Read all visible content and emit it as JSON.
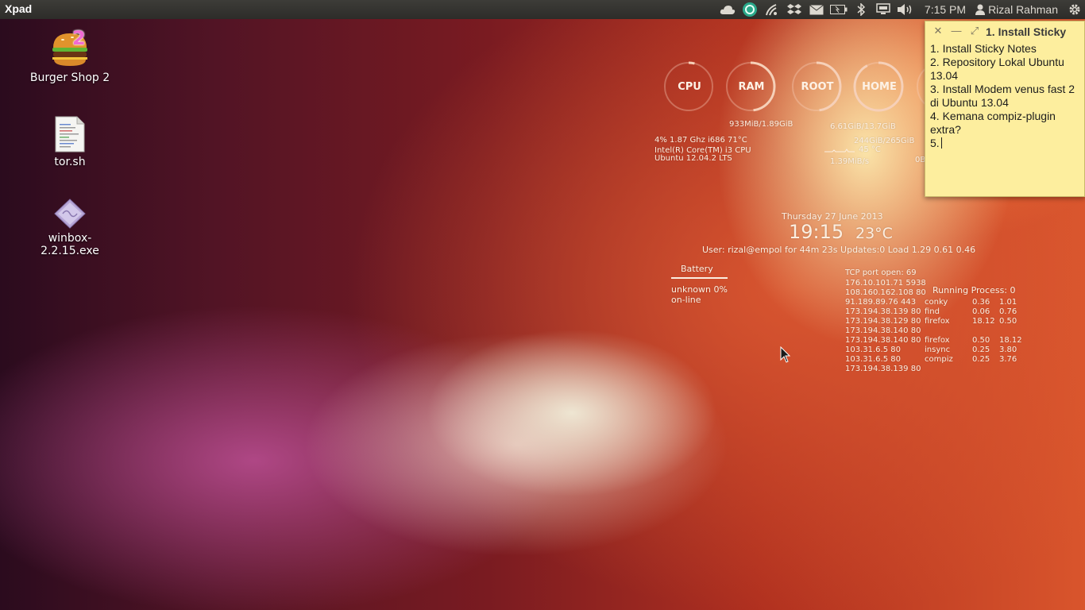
{
  "panel": {
    "app_title": "Xpad",
    "clock": "7:15 PM",
    "user": "Rizal Rahman",
    "indicators": [
      "cloud-icon",
      "sync-icon",
      "network-signal-icon",
      "dropbox-icon",
      "mail-icon",
      "battery-icon",
      "bluetooth-icon",
      "display-icon",
      "volume-icon",
      "user-icon",
      "session-gear-icon"
    ]
  },
  "desktop": {
    "icons": [
      {
        "label": "Burger Shop 2",
        "icon": "burger-game-icon"
      },
      {
        "label": "tor.sh",
        "icon": "text-file-icon"
      },
      {
        "label": "winbox-2.2.15.exe",
        "icon": "executable-icon"
      }
    ]
  },
  "conky": {
    "rings": [
      {
        "label": "CPU",
        "level": 0.04
      },
      {
        "label": "RAM",
        "level": 0.48
      },
      {
        "label": "ROOT",
        "level": 0.48
      },
      {
        "label": "HOME",
        "level": 0.92
      }
    ],
    "ram_text": "933MiB/1.89GiB",
    "root_text": "6.61GiB/13.7GiB",
    "home_text": "244GiB/265GiB",
    "cpu_line": "4% 1.87 Ghz i686  71°C",
    "cpu_model": "Intel(R) Core(TM) i3 CPU",
    "os": "Ubuntu 12.04.2 LTS",
    "disk_temp": "45 °C",
    "net_speed": "1.39MiB/s",
    "partial_text": "0B",
    "date": "Thursday 27 June 2013",
    "time": "19:15",
    "temp": "23°C",
    "user_line": "User: rizal@empol for 44m 23s  Updates:0   Load 1.29 0.61 0.46",
    "battery_title": "Battery",
    "battery_status": "unknown 0%",
    "battery_line": "on-line",
    "tcp_title": "TCP port open: 69",
    "tcp_ports": [
      "176.10.101.71 5938",
      "108.160.162.108 80",
      "91.189.89.76 443",
      "173.194.38.139 80",
      "173.194.38.129 80",
      "173.194.38.140 80",
      "173.194.38.140 80",
      "103.31.6.5 80",
      "103.31.6.5 80",
      "173.194.38.139 80"
    ],
    "process_title": "Running Process:  0",
    "processes_top": [
      {
        "name": "conky",
        "a": "0.36",
        "b": "1.01"
      },
      {
        "name": "find",
        "a": "0.06",
        "b": "0.76"
      },
      {
        "name": "firefox",
        "a": "18.12",
        "b": "0.50"
      }
    ],
    "processes_bottom": [
      {
        "name": "firefox",
        "a": "0.50",
        "b": "18.12"
      },
      {
        "name": "insync",
        "a": "0.25",
        "b": "3.80"
      },
      {
        "name": "compiz",
        "a": "0.25",
        "b": "3.76"
      }
    ]
  },
  "sticky": {
    "title": "1. Install Sticky",
    "close": "✕",
    "minimize": "—",
    "maximize": "⤢",
    "lines": [
      "1. Install Sticky Notes",
      "2. Repository Lokal Ubuntu 13.04",
      "3. Install Modem venus fast 2 di Ubuntu 13.04",
      "4. Kemana compiz-plugin extra?",
      "5."
    ]
  },
  "colors": {
    "panel": "#3d3c38",
    "sticky": "#fdee9e",
    "ring": "#f6d0b8"
  }
}
